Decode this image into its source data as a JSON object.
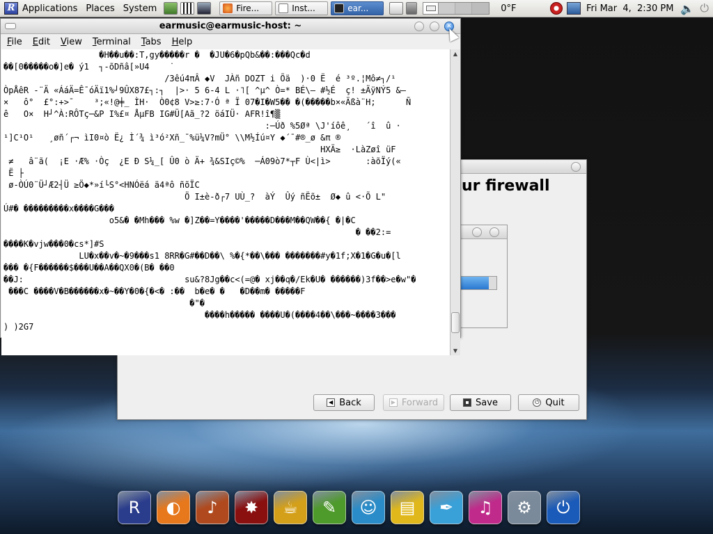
{
  "top_panel": {
    "menus": [
      "Applications",
      "Places",
      "System"
    ],
    "tasks": [
      {
        "label": "Fire...",
        "icon": "firefox-icon",
        "active": false
      },
      {
        "label": "Inst...",
        "icon": "installer-icon",
        "active": false
      },
      {
        "label": "ear...",
        "icon": "terminal-icon",
        "active": true
      }
    ],
    "temperature": "0°F",
    "clock": "Fri Mar  4,  2:30 PM"
  },
  "terminal": {
    "title": "earmusic@earmusic-host: ~",
    "menu": [
      "File",
      "Edit",
      "View",
      "Terminal",
      "Tabs",
      "Help"
    ],
    "lines": [
      "                   �H��u��:T,gy�����r �  �JU�6�pQb&��:���Qc�d",
      "��[0�����o�]e� ý1  ┐-õDñâ[»U4    ˙",
      "                                /3êú4πÂ ◆V  JÀñ DOZT i Õä  )·0 Ë  é ³º.¦Mô≠┐/¹",
      "ÒpÅêR -¨Ä «ÁáÄ=Ê¯óÄï1%┘9ÛX87£┐:┐  |>· 5 6-4 L ·˥[ ^µ^ Ò=* BÉ\\— #½É  ç! ±ÄÿNÝ5 &—",
      "×   ô°  £°:+>¯    ³;«!@╪_ ÌH·  Ò0¢8 V>≥:7·Ó ª Ï 07�I�W5�� �(�����b×«Äßà¨H;      Ñ",
      "ê   O×  H┘^À:RÔTç─&P I%£¤ ÅµFB IG#Ü[Aã_?2 öáIÜ· AFR!î¶▒",
      "                                                    :─Úð %5Øª \\J'íôê¸   ´î  û ·",
      "¹]C¹O¹   ¸øñ´┌¬ ìI0¤ò Ë¿ Ì´¾ ì³ó²Xñ_¯%ü¼V?mÜ° \\\\M½Íú¤Y ◆´¯#®_ø &π ®",
      "                                                               HXÄ≥  ·LàZøî üF",
      " ≠   â¨ã(  ¡E ·Æ% ·Òç  ¿E Ð S¼_[ Û0 ò Ä+ ¾&SIç©%  ─Á09ò7*┬F Ù<|ì>       :àõÏý(«",
      " Ë ├",
      " ø-ÒÚ0¨Ü┘Æ2┤Ü ≥Ö◆*»í└S°<HNÓëá ä4ªô ñõÏC",
      "                                    Ö I±è-ð┌7 UÙ_?  àÝ  Ûý ñËõ±  Ø◆ û <·Õ L\"",
      "Ú#� ���������x����G���",
      "                     o5&� �Mh��� %w �]Z��=Y����'�����D���M��QW��{ �|�C",
      "                                                                      � ��2:=",
      "����K�vjw���0�cs*]#S",
      "               LU�x��v�~�9���s1 8RR�G#��D��\\ %�{*��\\��� �������#y�1f;X�1�G�u�[l",
      "��� �{F������$���U��A��QX0�(B� ��0",
      "��J:                                su&?8Jg��c<(=@� xj��q�/Ek�U� ������)3f��>e�w\"�",
      " ���C ����V�B������x�~��Y�0�{�<� :��  b�e� �   �D��m� �����F",
      "                                     �\"�",
      "                                        ����h����� ����U�(����4��\\���~����3���",
      ") )2G7"
    ]
  },
  "installer": {
    "heading": "ur firewall",
    "buttons": {
      "back": "Back",
      "forward": "Forward",
      "save": "Save",
      "quit": "Quit"
    },
    "progress": 0.8
  },
  "dock": {
    "items": [
      {
        "name": "rhythmbox-icon",
        "glyph": "R",
        "color": "#2a3c8c"
      },
      {
        "name": "firefox-icon",
        "glyph": "◐",
        "color": "#e8781c"
      },
      {
        "name": "guitar-icon",
        "glyph": "♪",
        "color": "#b04a1e"
      },
      {
        "name": "burner-icon",
        "glyph": "✸",
        "color": "#8a1010"
      },
      {
        "name": "coffee-icon",
        "glyph": "☕",
        "color": "#d4a01a"
      },
      {
        "name": "tools-icon",
        "glyph": "✎",
        "color": "#4e9a2a"
      },
      {
        "name": "messenger-icon",
        "glyph": "☺",
        "color": "#2a8cc8"
      },
      {
        "name": "folders-icon",
        "glyph": "▤",
        "color": "#e0b81c"
      },
      {
        "name": "feather-icon",
        "glyph": "✒",
        "color": "#3aa0d8"
      },
      {
        "name": "itunes-icon",
        "glyph": "♫",
        "color": "#c02a8a"
      },
      {
        "name": "settings-icon",
        "glyph": "⚙",
        "color": "#7a8a9a"
      },
      {
        "name": "power-icon",
        "glyph": "⏻",
        "color": "#1a5ab8"
      }
    ]
  }
}
